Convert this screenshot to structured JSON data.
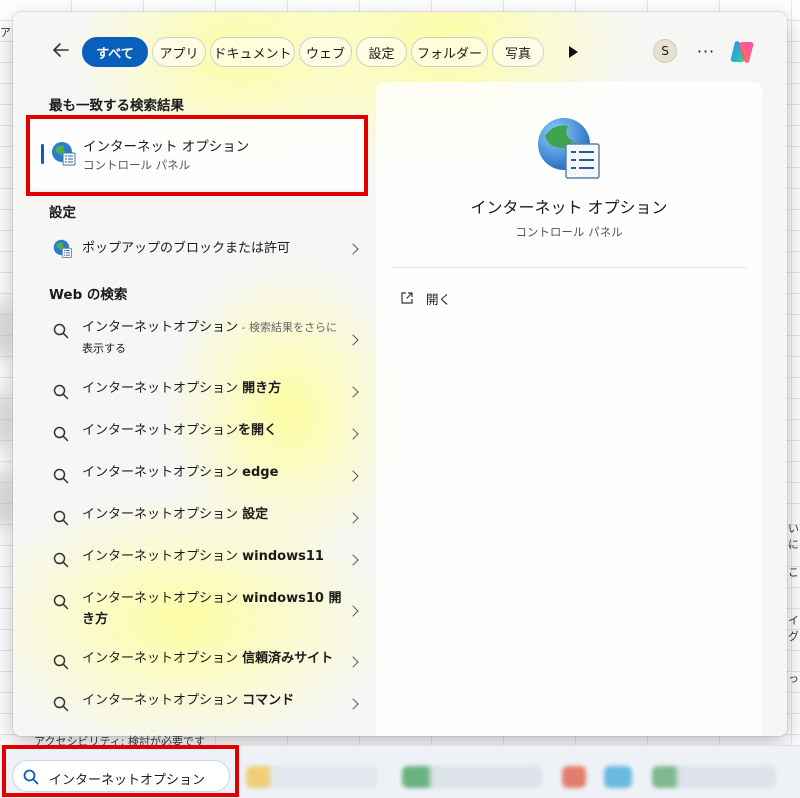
{
  "filters": {
    "back_label": "",
    "chips": [
      {
        "label": "すべて",
        "active": true
      },
      {
        "label": "アプリ",
        "active": false
      },
      {
        "label": "ドキュメント",
        "active": false
      },
      {
        "label": "ウェブ",
        "active": false
      },
      {
        "label": "設定",
        "active": false
      },
      {
        "label": "フォルダー",
        "active": false
      },
      {
        "label": "写真",
        "active": false
      }
    ],
    "avatar_initial": "S",
    "more_label": "···"
  },
  "best_match": {
    "heading": "最も一致する検索結果",
    "name": "インターネット オプション",
    "subtitle": "コントロール パネル"
  },
  "settings": {
    "heading": "設定",
    "items": [
      {
        "label": "ポップアップのブロックまたは許可"
      }
    ]
  },
  "web": {
    "heading": "Web の検索",
    "items": [
      {
        "base": "インターネットオプション",
        "bold": "",
        "hint": " - 検索結果をさらに",
        "line2": "表示する"
      },
      {
        "base": "インターネットオプション ",
        "bold": "開き方",
        "hint": "",
        "line2": ""
      },
      {
        "base": "インターネットオプション",
        "bold": "を開く",
        "hint": "",
        "line2": ""
      },
      {
        "base": "インターネットオプション ",
        "bold": "edge",
        "hint": "",
        "line2": ""
      },
      {
        "base": "インターネットオプション ",
        "bold": "設定",
        "hint": "",
        "line2": ""
      },
      {
        "base": "インターネットオプション ",
        "bold": "windows11",
        "hint": "",
        "line2": ""
      },
      {
        "base": "インターネットオプション ",
        "bold": "windows10 開",
        "hint": "",
        "line2": "き方"
      },
      {
        "base": "インターネットオプション ",
        "bold": "信頼済みサイト",
        "hint": "",
        "line2": ""
      },
      {
        "base": "インターネットオプション ",
        "bold": "コマンド",
        "hint": "",
        "line2": ""
      }
    ]
  },
  "details": {
    "title": "インターネット オプション",
    "subtitle": "コントロール パネル",
    "actions": [
      {
        "label": "開く"
      }
    ]
  },
  "taskbar": {
    "search_value": "インターネットオプション",
    "accessibility_text": "アクセシビリティ: 検討が必要です"
  },
  "colors": {
    "accent": "#0a5fbd",
    "highlight_frame": "#e10000"
  }
}
